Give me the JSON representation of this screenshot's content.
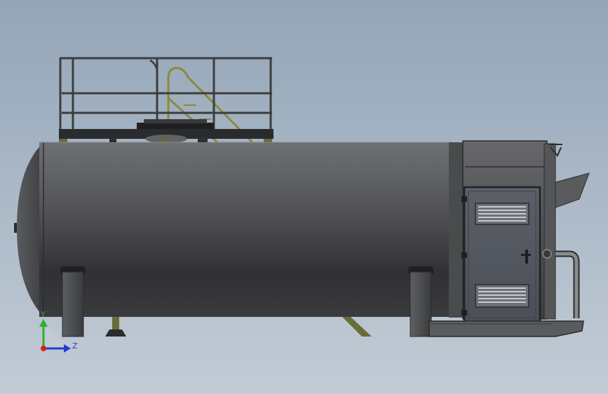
{
  "viewport": {
    "background_top": "#93a5b8",
    "background_bottom": "#c3ccd6"
  },
  "model": {
    "parts": [
      "horizontal-tank",
      "top-platform",
      "guard-railing",
      "ladder",
      "saddle-supports",
      "equipment-cabinet",
      "access-door",
      "ventilation-louvers",
      "side-pipe",
      "discharge-chute",
      "skid-frame"
    ],
    "tank_color": "#4a4b4d",
    "structure_color": "#6b6b3a",
    "door_color": "#565a63"
  },
  "triad": {
    "y_label": "Y",
    "z_label": "Z",
    "y_color": "#2fae2f",
    "z_color": "#1f3fd0",
    "x_color": "#d42020"
  }
}
